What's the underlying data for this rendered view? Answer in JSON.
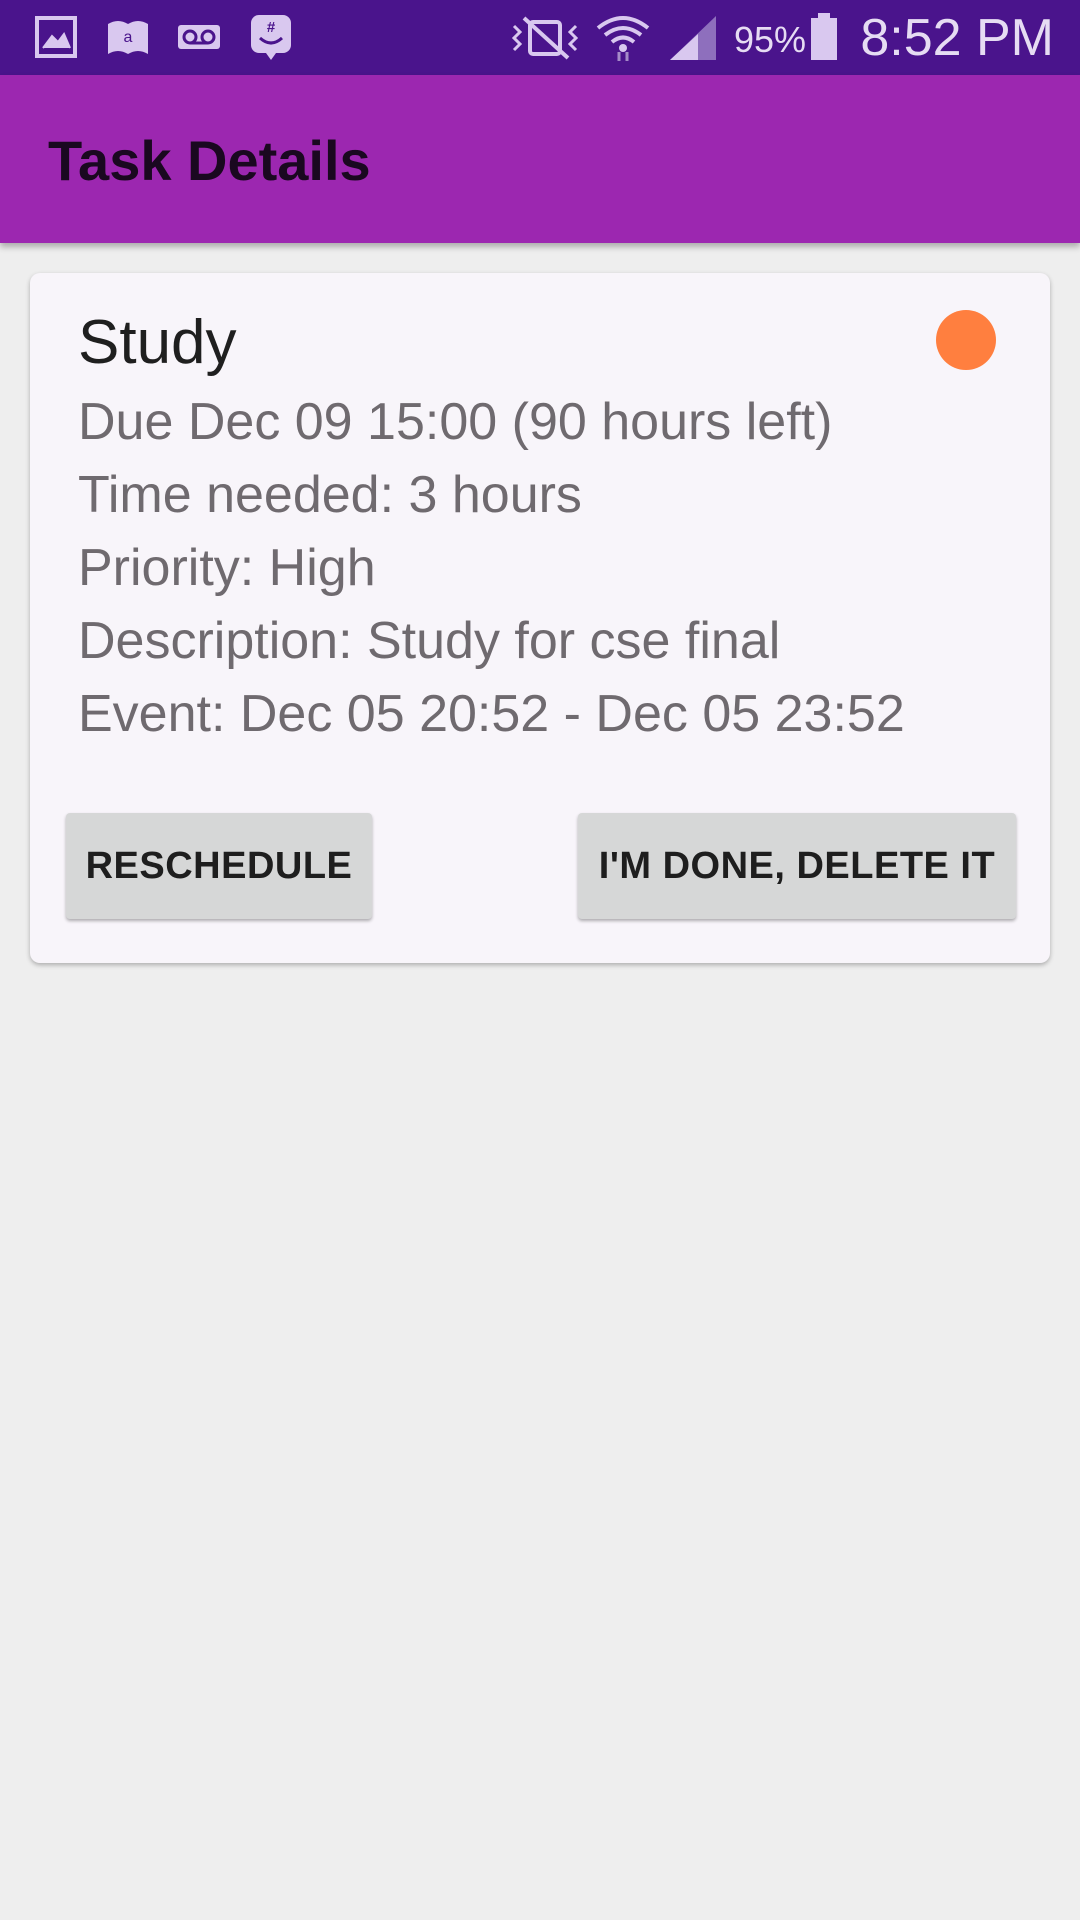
{
  "status_bar": {
    "time": "8:52 PM",
    "battery_percent": "95%",
    "battery_level": 0.95,
    "icons_left": [
      "gallery-icon",
      "amazon-kindle-icon",
      "voicemail-icon",
      "groupme-icon"
    ],
    "icons_right": [
      "mute-vibrate-icon",
      "wifi-icon",
      "signal-icon",
      "battery-icon"
    ]
  },
  "app_bar": {
    "title": "Task Details",
    "color": "#9c27b0"
  },
  "task": {
    "name": "Study",
    "priority_color": "#ff7f3f",
    "due": "Due Dec 09 15:00 (90 hours left)",
    "time_needed": "Time needed: 3 hours",
    "priority": "Priority: High",
    "description": "Description: Study for cse final",
    "event": "Event: Dec 05 20:52 - Dec 05 23:52"
  },
  "actions": {
    "reschedule_label": "RESCHEDULE",
    "delete_label": "I'M DONE, DELETE IT"
  }
}
